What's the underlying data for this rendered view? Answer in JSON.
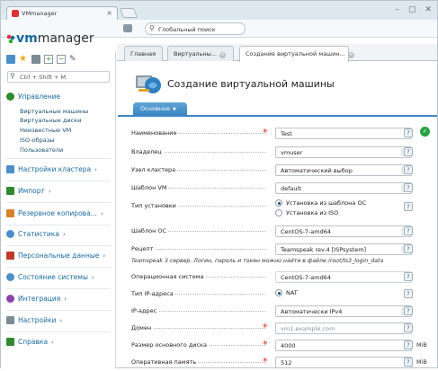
{
  "browser": {
    "tab_title": "VMmanager",
    "search_placeholder": "Глобальный поиск"
  },
  "logo": {
    "prefix": "vm",
    "suffix": "manager"
  },
  "sidebar": {
    "search_placeholder": "Ctrl + Shift + M",
    "sections": [
      {
        "label": "Управление",
        "items": [
          "Виртуальные машины",
          "Виртуальные диски",
          "Неизвестные VM",
          "ISO-образы",
          "Пользователи"
        ]
      },
      {
        "label": "Настройки кластера"
      },
      {
        "label": "Импорт"
      },
      {
        "label": "Резервное копирова..."
      },
      {
        "label": "Статистика"
      },
      {
        "label": "Персональные данные"
      },
      {
        "label": "Состояние системы"
      },
      {
        "label": "Интеграция"
      },
      {
        "label": "Настройки"
      },
      {
        "label": "Справка"
      }
    ]
  },
  "tabs": [
    "Главная",
    "Виртуальны...",
    "Создание виртуальной машин..."
  ],
  "page": {
    "title": "Создание виртуальной машины",
    "form_tab": "Основное"
  },
  "form": {
    "name": {
      "label": "Наименование",
      "value": "Test"
    },
    "owner": {
      "label": "Владелец",
      "value": "vmuser"
    },
    "node": {
      "label": "Узел кластера",
      "value": "Автоматический выбор"
    },
    "vm_template": {
      "label": "Шаблон VM",
      "value": "default"
    },
    "install_type": {
      "label": "Тип установки",
      "options": [
        "Установка из шаблона ОС",
        "Установка из ISO"
      ]
    },
    "os_template": {
      "label": "Шаблон ОС",
      "value": "CentOS-7-amd64"
    },
    "recipe": {
      "label": "Рецепт",
      "value": "Teamspeak rev.4 [ISPsystem]"
    },
    "recipe_note": "Teamspeak 3 сервер. Логин, пароль и токен можно найти в файле /root/ts3_login_data",
    "os": {
      "label": "Операционная система",
      "value": "CentOS-7-amd64"
    },
    "ip_type": {
      "label": "Тип IP-адреса",
      "option": "NAT"
    },
    "ip": {
      "label": "IP-адрес",
      "value": "Автоматически IPv4"
    },
    "domain": {
      "label": "Домен",
      "placeholder": "vm1.example.com"
    },
    "disk": {
      "label": "Размер основного диска",
      "value": "4000",
      "unit": "MiB"
    },
    "ram": {
      "label": "Оперативная память",
      "value": "512",
      "unit": "MiB"
    }
  }
}
